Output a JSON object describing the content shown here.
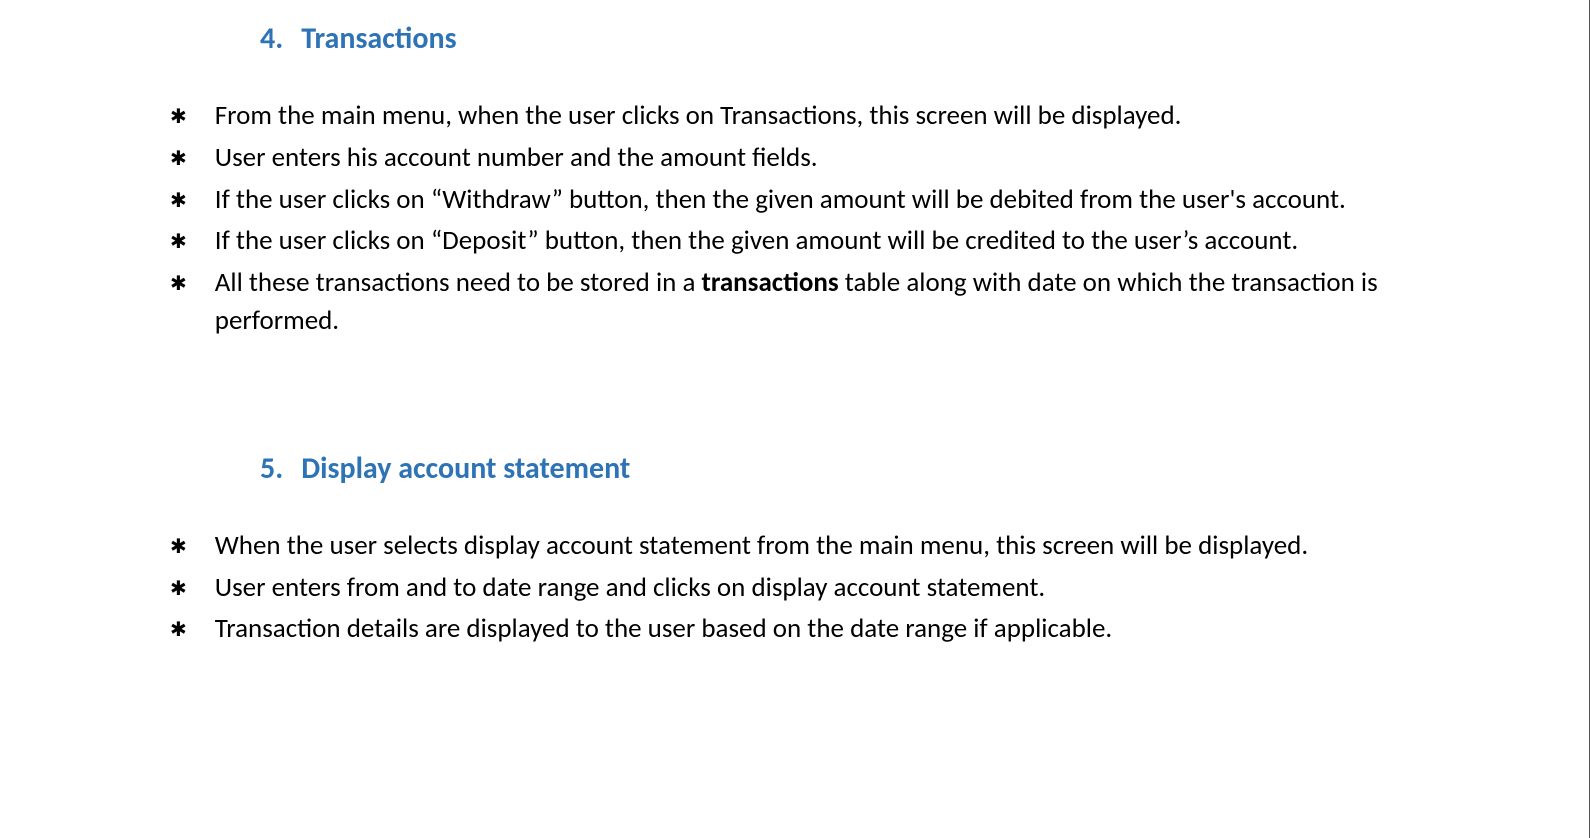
{
  "sections": [
    {
      "number": "4.",
      "title": "Transactions",
      "bullets": [
        {
          "parts": [
            {
              "text": "From the main menu, when the user clicks on Transactions, this screen will be displayed.",
              "bold": false
            }
          ]
        },
        {
          "parts": [
            {
              "text": "User enters his account number and the amount fields.",
              "bold": false
            }
          ]
        },
        {
          "parts": [
            {
              "text": "If the user clicks on “Withdraw” button, then the given amount will be debited from the user's account.",
              "bold": false
            }
          ]
        },
        {
          "parts": [
            {
              "text": "If the user clicks on “Deposit” button, then the given amount will be credited to the user’s account.",
              "bold": false
            }
          ]
        },
        {
          "parts": [
            {
              "text": "All these transactions need to be stored in a ",
              "bold": false
            },
            {
              "text": "transactions",
              "bold": true
            },
            {
              "text": " table along with date on which the transaction is performed.",
              "bold": false
            }
          ]
        }
      ]
    },
    {
      "number": "5.",
      "title": "Display account statement",
      "bullets": [
        {
          "parts": [
            {
              "text": "When the user selects display account statement from the main menu, this screen will be displayed.",
              "bold": false
            }
          ]
        },
        {
          "parts": [
            {
              "text": "User enters from and to date range and clicks on display account statement.",
              "bold": false
            }
          ]
        },
        {
          "parts": [
            {
              "text": "Transaction details are displayed to the user based on the date range if applicable.",
              "bold": false
            }
          ]
        }
      ]
    }
  ]
}
